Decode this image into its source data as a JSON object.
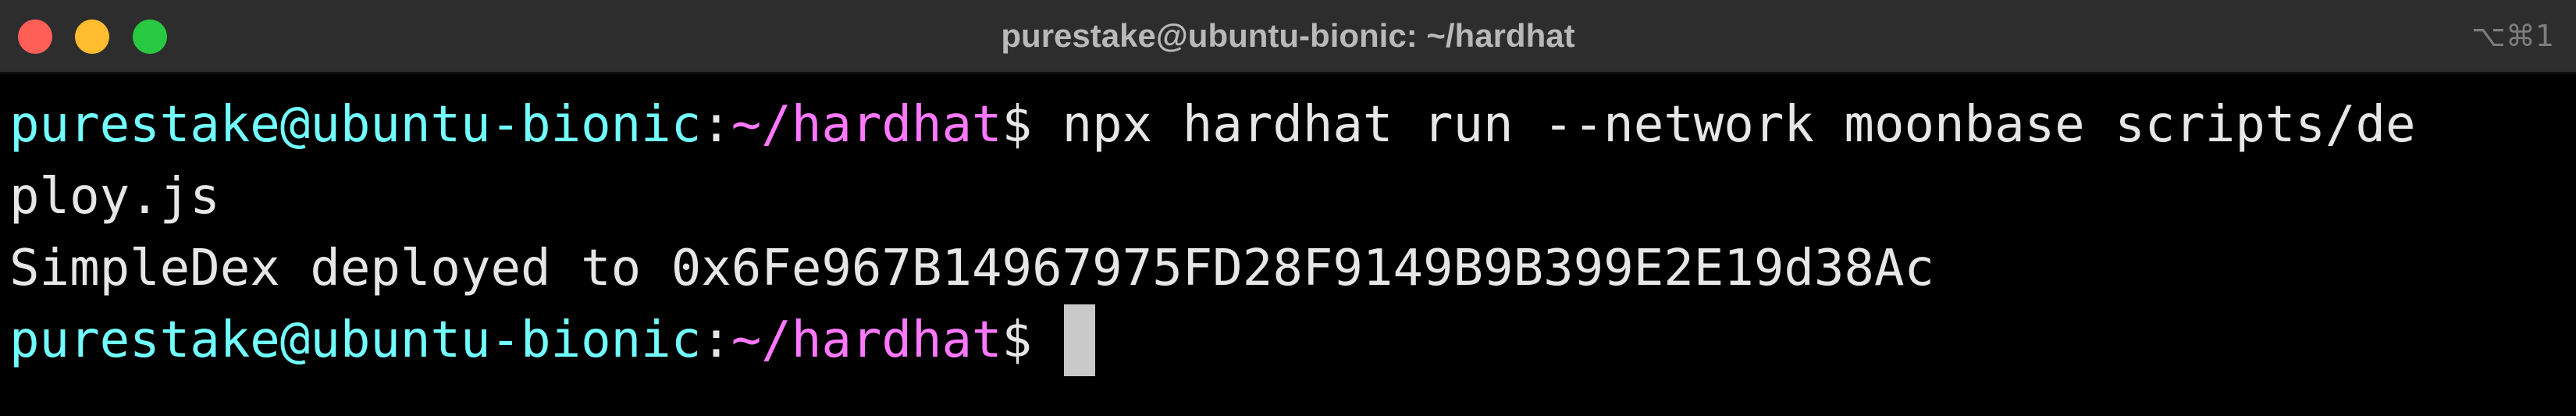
{
  "window": {
    "title": "purestake@ubuntu-bionic: ~/hardhat",
    "shortcut": "⌥⌘1",
    "controls": {
      "close_color": "#ff5f57",
      "minimize_color": "#febc2e",
      "zoom_color": "#28c840"
    }
  },
  "terminal": {
    "prompt_user": "purestake@ubuntu-bionic",
    "prompt_colon": ":",
    "prompt_path": "~/hardhat",
    "prompt_dollar": "$",
    "command_part1": " npx hardhat run --network moonbase scripts/de",
    "command_part2": "ploy.js",
    "output": "SimpleDex deployed to 0x6Fe967B14967975FD28F9149B9B399E2E19d38Ac",
    "user_color": "#71ffff",
    "path_color": "#ff78ff"
  }
}
